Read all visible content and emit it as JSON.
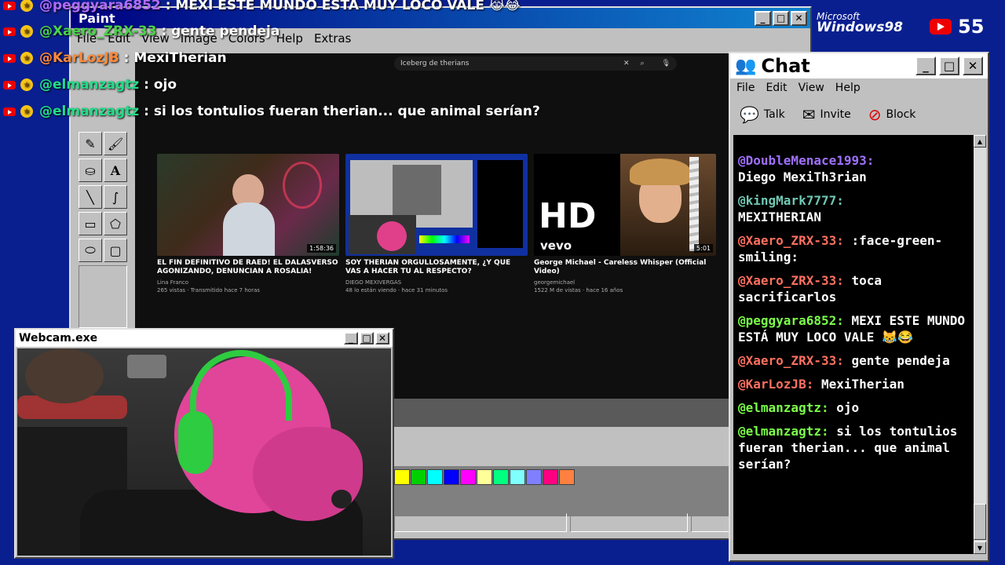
{
  "paint": {
    "title": "Paint",
    "menu": [
      "File",
      "Edit",
      "View",
      "Image",
      "Colors",
      "Help",
      "Extras"
    ],
    "palette": [
      "#ffff00",
      "#00d000",
      "#00ffff",
      "#0000ff",
      "#ff00ff",
      "#ffff99",
      "#00ff80",
      "#80ffff",
      "#8080ff",
      "#ff0080",
      "#ff8040"
    ]
  },
  "video": {
    "search": "Iceberg de therians",
    "cards": [
      {
        "title": "EL FIN DEFINITIVO DE RAED! EL DALASVERSO AGONIZANDO, DENUNCIAN A ROSALIA!",
        "channel": "Lina Franco",
        "meta": "265 vistas · Transmitido hace 7 horas",
        "duration": "1:58:36"
      },
      {
        "title": "SOY THERIAN ORGULLOSAMENTE, ¿Y QUE VAS A HACER TU AL RESPECTO?",
        "channel": "DIEGO MEXIVERGAS",
        "meta": "48 lo están viendo · hace 31 minutos",
        "duration": ""
      },
      {
        "title": "George Michael - Careless Whisper (Official Video)",
        "channel": "georgemichael",
        "meta": "1522 M de vistas · hace 16 años",
        "duration": "5:01",
        "hd": "HD",
        "vevo": "vevo"
      }
    ]
  },
  "overlay_chat": [
    {
      "user": "@peggyara6852",
      "text": ": MEXI ESTE MUNDO ESTA MUY LOCO VALE 😹😂",
      "color": "#b06cff"
    },
    {
      "user": "@Xaero_ZRX-33",
      "text": ": gente pendeja",
      "color": "#4ad24a"
    },
    {
      "user": "@KarLozJB",
      "text": ": MexiTherian",
      "color": "#ff8a3a"
    },
    {
      "user": "@elmanzagtz",
      "text": ": ojo",
      "color": "#22dd88"
    },
    {
      "user": "@elmanzagtz",
      "text": ": si los tontulios fueran therian... que animal serían?",
      "color": "#22dd88"
    }
  ],
  "webcam": {
    "title": "Webcam.exe"
  },
  "chat": {
    "title": "Chat",
    "menu": [
      "File",
      "Edit",
      "View",
      "Help"
    ],
    "toolbar": [
      "Talk",
      "Invite",
      "Block"
    ],
    "messages": [
      {
        "user": "@DoubleMenace1993:",
        "text": "Diego MexiTh3rian",
        "color": "#a070ff"
      },
      {
        "user": "@kingMark7777:",
        "text": "MEXITHERIAN",
        "color": "#70c8b4"
      },
      {
        "user": "@Xaero_ZRX-33:",
        "text": ":face-green-smiling:",
        "color": "#ff7060"
      },
      {
        "user": "@Xaero_ZRX-33:",
        "text": "toca sacrificarlos",
        "color": "#ff7060"
      },
      {
        "user": "@peggyara6852:",
        "text": "MEXI ESTE MUNDO ESTÁ MUY LOCO VALE 😹😂",
        "color": "#7cff4a"
      },
      {
        "user": "@Xaero_ZRX-33:",
        "text": "gente pendeja",
        "color": "#ff7060"
      },
      {
        "user": "@KarLozJB:",
        "text": "MexiTherian",
        "color": "#ff7060"
      },
      {
        "user": "@elmanzagtz:",
        "text": "ojo",
        "color": "#7cff4a"
      },
      {
        "user": "@elmanzagtz:",
        "text": "si los tontulios fueran therian... que animal serían?",
        "color": "#7cff4a"
      }
    ]
  },
  "brand": {
    "microsoft": "Microsoft",
    "windows": "Windows98"
  },
  "viewer_count": "55"
}
